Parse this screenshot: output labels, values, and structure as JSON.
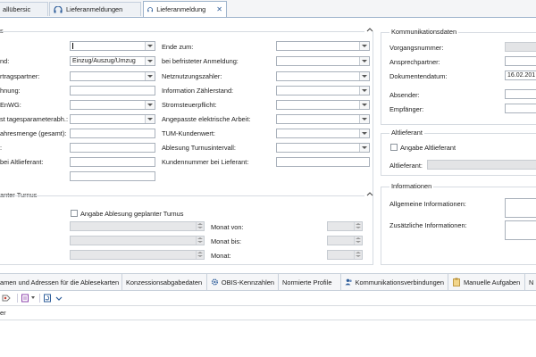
{
  "tabs": [
    {
      "label": "allübersic",
      "active": false
    },
    {
      "label": "Lieferanmeldungen",
      "active": false
    },
    {
      "label": "Lieferanmeldung",
      "active": true
    }
  ],
  "left_col1": {
    "labels": [
      "nd:",
      "rtragspartner:",
      "hnung:",
      "EnWG:",
      "st tagesparameterabh.:",
      "ahresmenge (gesamt):",
      ":",
      "bei Altlieferant:"
    ],
    "status_value": "Einzug/Auszug/Umzug"
  },
  "left_col2": {
    "labels": [
      "Ende zum:",
      "bei befristeter Anmeldung:",
      "Netznutzungszahler:",
      "Information Zählerstand:",
      "Stromsteuerpflicht:",
      "Angepasste elektrische Arbeit:",
      "TUM-Kundenwert:",
      "Ablesung Turnusintervall:",
      "Kundennummer bei Lieferant:"
    ]
  },
  "turnus": {
    "title": "anter Turnus",
    "checkbox_label": "Angabe Ablesung geplanter Turnus",
    "labels": [
      "Monat von:",
      "Monat bis:",
      "Monat:"
    ]
  },
  "kommunikation": {
    "title": "Kommunikationsdaten",
    "labels": [
      "Vorgangsnummer:",
      "Ansprechpartner:",
      "Dokumentendatum:",
      "Absender:",
      "Empfänger:"
    ],
    "date_value": "16.02.201"
  },
  "altlieferant": {
    "title": "Altlieferant",
    "checkbox_label": "Angabe Altlieferant",
    "field_label": "Altlieferant:"
  },
  "informationen": {
    "title": "Informationen",
    "labels": [
      "Allgemeine Informationen:",
      "Zusätzliche Informationen:"
    ]
  },
  "bottom_tabs": [
    "amen und Adressen für die Ablesekarten",
    "Konzessionsabgabedaten",
    "OBIS-Kennzahlen",
    "Normierte Profile",
    "Kommunikationsverbindungen",
    "Manuelle Aufgaben",
    "N"
  ],
  "footer_label": "er",
  "colors": {
    "accent": "#2d5d9a",
    "border": "#a9b1bb",
    "group": "#d6dbe1"
  }
}
